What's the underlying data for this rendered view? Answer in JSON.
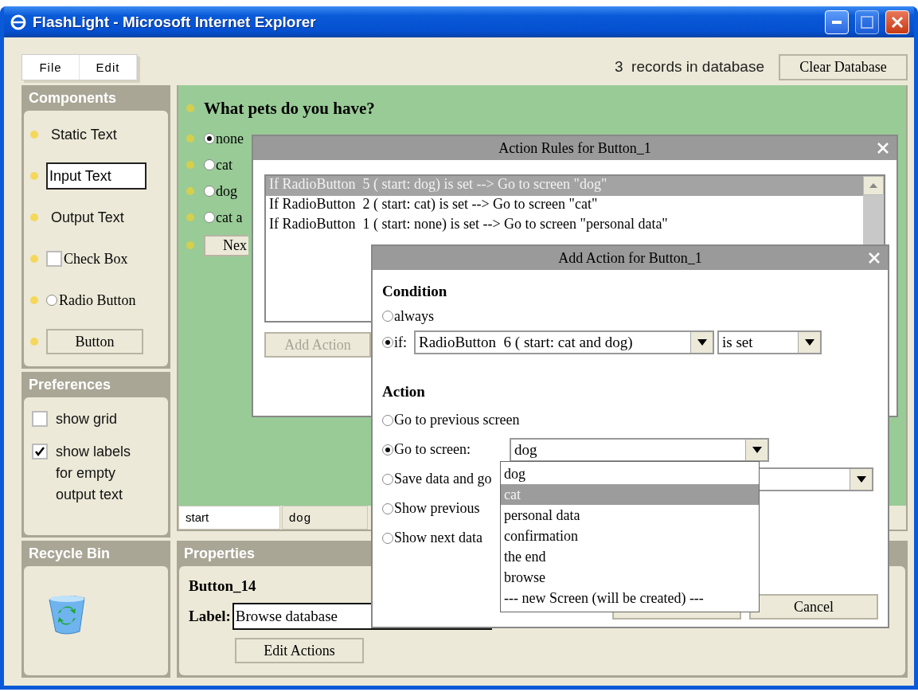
{
  "window": {
    "title": "FlashLight - Microsoft Internet Explorer"
  },
  "menu": [
    "File",
    "Edit"
  ],
  "record_count": "3  records in database",
  "clear_button": "Clear Database",
  "components": {
    "title": "Components",
    "items": [
      {
        "kind": "static",
        "label": "Static Text"
      },
      {
        "kind": "input",
        "label": "Input Text"
      },
      {
        "kind": "output",
        "label": "Output Text"
      },
      {
        "kind": "checkbox",
        "label": "Check Box",
        "checked": false
      },
      {
        "kind": "radio",
        "label": "Radio Button",
        "selected": false
      },
      {
        "kind": "button",
        "label": "Button"
      }
    ]
  },
  "preferences": {
    "title": "Preferences",
    "options": [
      {
        "label": "show grid",
        "checked": false
      },
      {
        "label": "show labels for empty output text",
        "checked": true
      }
    ]
  },
  "recycle_bin": {
    "title": "Recycle Bin"
  },
  "canvas": {
    "question": "What pets do you have?",
    "radios": [
      {
        "label": "none",
        "selected": true
      },
      {
        "label": "cat",
        "selected": false
      },
      {
        "label": "dog",
        "selected": false
      },
      {
        "label": "cat a",
        "selected": false
      }
    ],
    "button": "Nex"
  },
  "screen_tabs": [
    {
      "label": "start",
      "selected": true
    },
    {
      "label": "dog",
      "selected": false
    }
  ],
  "properties": {
    "title": "Properties",
    "name": "Button_14",
    "label_caption": "Label:",
    "label_value": "Browse database",
    "edit_button": "Edit Actions"
  },
  "rules_dialog": {
    "title": "Action Rules for Button_1",
    "rules": [
      {
        "text": "If RadioButton  5 ( start: dog) is set --> Go to screen \"dog\"",
        "selected": true
      },
      {
        "text": "If RadioButton  2 ( start: cat) is set --> Go to screen \"cat\"",
        "selected": false
      },
      {
        "text": "If RadioButton  1 ( start: none) is set --> Go to screen \"personal data\"",
        "selected": false
      }
    ],
    "add_button": {
      "label": "Add Action",
      "disabled": true
    }
  },
  "add_dialog": {
    "title": "Add Action for Button_1",
    "condition_heading": "Condition",
    "conditions": [
      {
        "label": "always",
        "selected": false
      },
      {
        "label": "if:",
        "selected": true
      }
    ],
    "condition_select": "RadioButton  6 ( start: cat and dog)",
    "state_select": "is set",
    "action_heading": "Action",
    "actions": [
      {
        "kind": "plain",
        "label": "Go to previous screen",
        "selected": false
      },
      {
        "kind": "screen",
        "label": "Go to screen:",
        "selected": true
      },
      {
        "kind": "save",
        "label": "Save data and go",
        "selected": false
      },
      {
        "kind": "plain",
        "label": "Show previous",
        "selected": false
      },
      {
        "kind": "plain",
        "label": "Show next data",
        "selected": false
      }
    ],
    "screen_select": "dog",
    "screen_options": [
      {
        "label": "dog",
        "selected": false
      },
      {
        "label": "cat",
        "selected": true
      },
      {
        "label": "personal data",
        "selected": false
      },
      {
        "label": "confirmation",
        "selected": false
      },
      {
        "label": "the end",
        "selected": false
      },
      {
        "label": "browse",
        "selected": false
      },
      {
        "label": "--- new Screen (will be created) ---",
        "selected": false
      }
    ],
    "cancel_button": "Cancel"
  }
}
